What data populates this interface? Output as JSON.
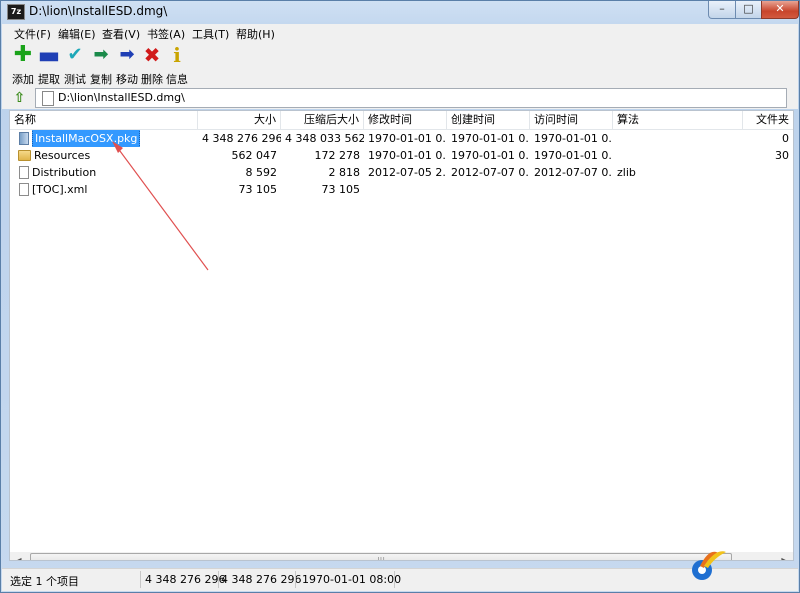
{
  "window": {
    "title": "D:\\lion\\InstallESD.dmg\\",
    "app_icon_text": "7z"
  },
  "menu": [
    "文件(F)",
    "编辑(E)",
    "查看(V)",
    "书签(A)",
    "工具(T)",
    "帮助(H)"
  ],
  "toolbar": [
    {
      "label": "添加",
      "icon": "plus-icon"
    },
    {
      "label": "提取",
      "icon": "minus-icon"
    },
    {
      "label": "测试",
      "icon": "check-icon"
    },
    {
      "label": "复制",
      "icon": "copy-arrow-icon"
    },
    {
      "label": "移动",
      "icon": "move-arrow-icon"
    },
    {
      "label": "删除",
      "icon": "delete-x-icon"
    },
    {
      "label": "信息",
      "icon": "info-icon"
    }
  ],
  "address": {
    "path": "D:\\lion\\InstallESD.dmg\\"
  },
  "columns": [
    "名称",
    "大小",
    "压缩后大小",
    "修改时间",
    "创建时间",
    "访问时间",
    "算法",
    "文件夹"
  ],
  "rows": [
    {
      "name": "InstallMacOSX.pkg",
      "type": "pkg",
      "size": "4 348 276 296",
      "packed": "4 348 033 562",
      "modified": "1970-01-01 0...",
      "created": "1970-01-01 0...",
      "accessed": "1970-01-01 0...",
      "method": "",
      "folders": "0",
      "selected": true
    },
    {
      "name": "Resources",
      "type": "folder",
      "size": "562 047",
      "packed": "172 278",
      "modified": "1970-01-01 0...",
      "created": "1970-01-01 0...",
      "accessed": "1970-01-01 0...",
      "method": "",
      "folders": "30",
      "selected": false
    },
    {
      "name": "Distribution",
      "type": "file",
      "size": "8 592",
      "packed": "2 818",
      "modified": "2012-07-05 2...",
      "created": "2012-07-07 0...",
      "accessed": "2012-07-07 0...",
      "method": "zlib",
      "folders": "",
      "selected": false
    },
    {
      "name": "[TOC].xml",
      "type": "file",
      "size": "73 105",
      "packed": "73 105",
      "modified": "",
      "created": "",
      "accessed": "",
      "method": "",
      "folders": "",
      "selected": false
    }
  ],
  "status": {
    "selected": "选定 1 个项目",
    "size": "4 348 276 296",
    "packed": "4 348 276 296",
    "date": "1970-01-01 08:00"
  },
  "colors": {
    "selection": "#3399ff",
    "annotation_arrow": "#e05050"
  }
}
